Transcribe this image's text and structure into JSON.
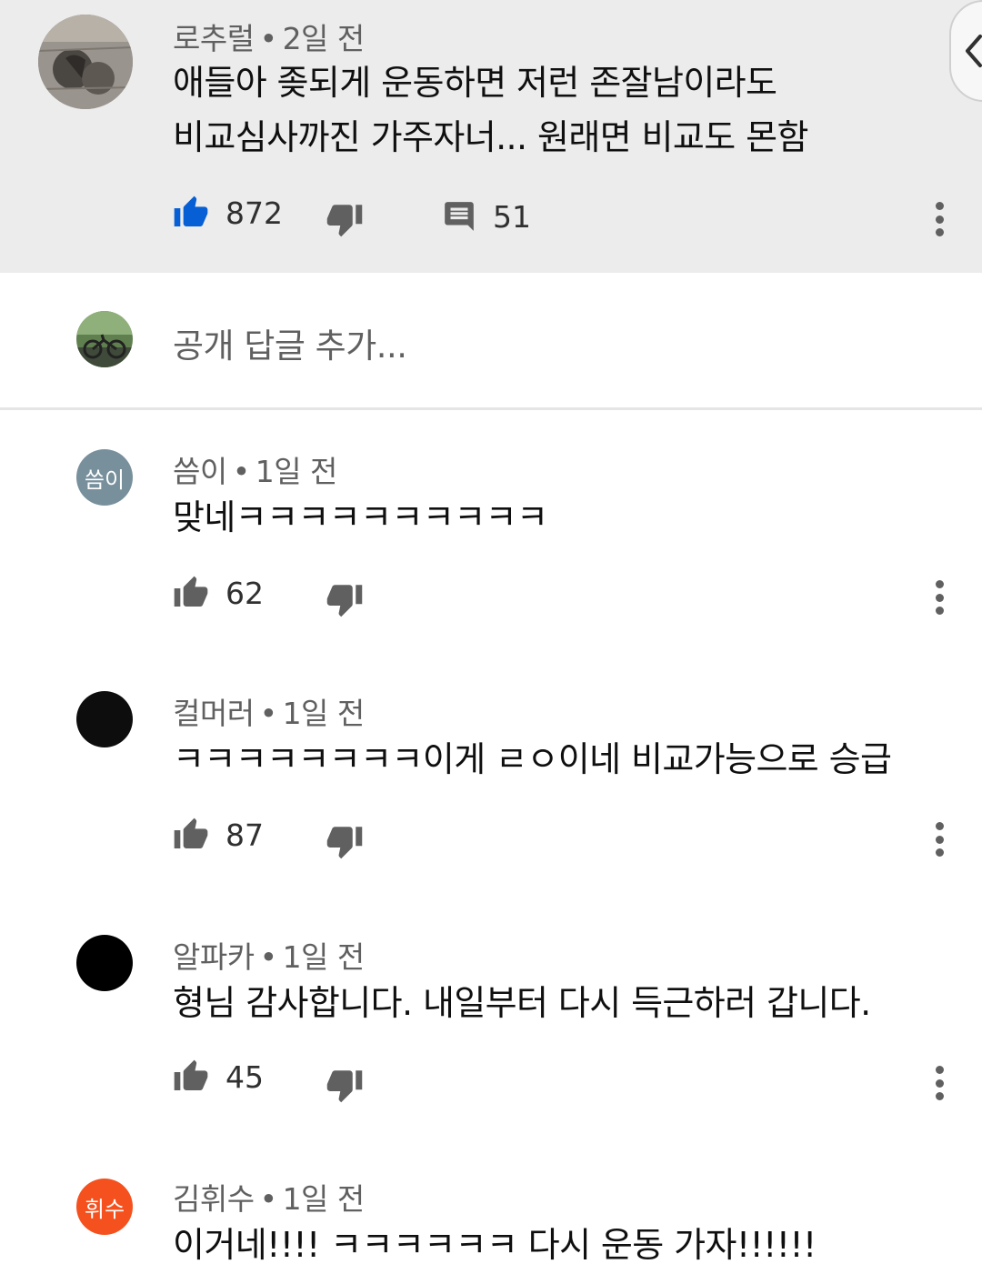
{
  "parent_comment": {
    "author": "로추럴",
    "time": "2일 전",
    "lines": [
      "애들아 좆되게 운동하면 저런 존잘남이라도",
      "비교심사까진 가주자너... 원래면 비교도 몬함"
    ],
    "likes": "872",
    "replies": "51"
  },
  "reply_box": {
    "placeholder": "공개 답글 추가..."
  },
  "comments": [
    {
      "author": "씀이",
      "time": "1일 전",
      "avatar_text": "씀이",
      "avatar_color": "#78909c",
      "text": "맞네ㅋㅋㅋㅋㅋㅋㅋㅋㅋㅋ",
      "likes": "62"
    },
    {
      "author": "컬머러",
      "time": "1일 전",
      "avatar_color": "#0d0d0d",
      "text": "ㅋㅋㅋㅋㅋㅋㅋㅋ이게 ㄹㅇ이네 비교가능으로 승급",
      "likes": "87"
    },
    {
      "author": "알파카",
      "time": "1일 전",
      "avatar_color": "#000000",
      "text": "형님 감사합니다. 내일부터 다시 득근하러 갑니다.",
      "likes": "45"
    },
    {
      "author": "김휘수",
      "time": "1일 전",
      "avatar_text": "휘수",
      "avatar_color": "#f4511e",
      "text": "이거네!!!! ㅋㅋㅋㅋㅋㅋ 다시 운동 가자!!!!!!"
    }
  ],
  "colors": {
    "liked": "#065fd4",
    "icon": "#606060",
    "highlight_bg": "#ececec"
  },
  "icons": [
    "thumb-up-icon",
    "thumb-down-icon",
    "reply-comment-icon",
    "more-vert-icon",
    "chevron-left-icon"
  ]
}
